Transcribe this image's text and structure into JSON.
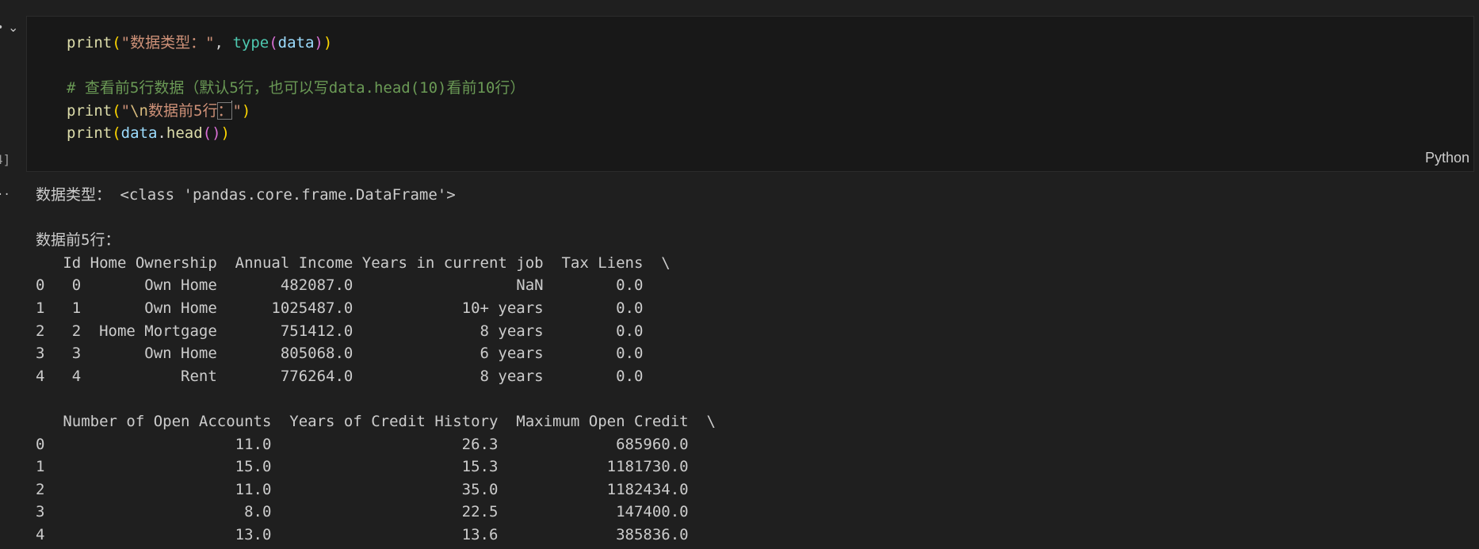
{
  "gutter": {
    "collapse_icon": "chevron-down-icon",
    "execution_count": "4]",
    "output_menu_icon": "ellipsis-icon"
  },
  "cell": {
    "language": "Python",
    "code": {
      "line1": {
        "fn": "print",
        "p_open": "(",
        "str": "\"数据类型：\"",
        "comma": ", ",
        "builtin": "type",
        "p2_open": "(",
        "var": "data",
        "p2_close": ")",
        "p_close": ")"
      },
      "line3": {
        "comment": "# 查看前5行数据（默认5行，也可以写data.head(10)看前10行）"
      },
      "line4": {
        "fn": "print",
        "p_open": "(",
        "str_open": "\"",
        "esc": "\\n",
        "str_body": "数据前5行",
        "str_sel": "：",
        "str_close": "\"",
        "p_close": ")"
      },
      "line5": {
        "fn": "print",
        "p_open": "(",
        "var": "data",
        "dot": ".",
        "method": "head",
        "p2": "()",
        "p_close": ")"
      }
    }
  },
  "output": {
    "lines": [
      "数据类型： <class 'pandas.core.frame.DataFrame'>",
      "",
      "数据前5行：",
      "   Id Home Ownership  Annual Income Years in current job  Tax Liens  \\",
      "0   0       Own Home       482087.0                  NaN        0.0",
      "1   1       Own Home      1025487.0            10+ years        0.0",
      "2   2  Home Mortgage       751412.0              8 years        0.0",
      "3   3       Own Home       805068.0              6 years        0.0",
      "4   4           Rent       776264.0              8 years        0.0",
      "",
      "   Number of Open Accounts  Years of Credit History  Maximum Open Credit  \\",
      "0                     11.0                     26.3             685960.0",
      "1                     15.0                     15.3            1181730.0",
      "2                     11.0                     35.0            1182434.0",
      "3                      8.0                     22.5             147400.0",
      "4                     13.0                     13.6             385836.0"
    ]
  }
}
